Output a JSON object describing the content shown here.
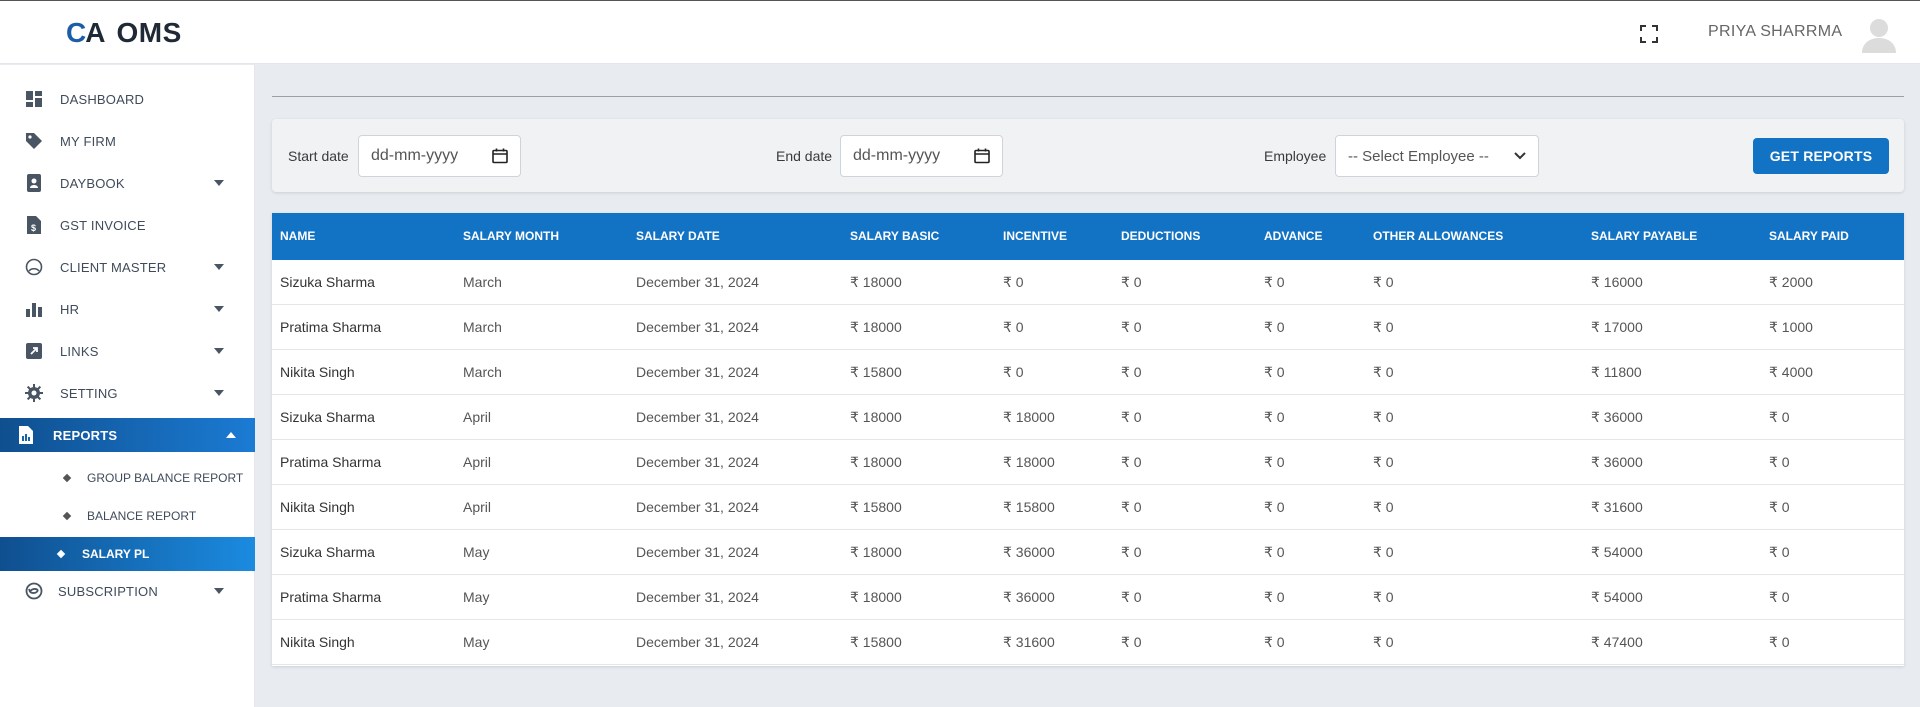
{
  "header": {
    "logo_mark_c": "C",
    "logo_mark_a": "A",
    "logo_text": "OMS",
    "username": "PRIYA SHARRMA"
  },
  "sidebar": {
    "items": [
      {
        "label": "DASHBOARD",
        "icon": "dashboard-icon"
      },
      {
        "label": "MY FIRM",
        "icon": "tag-icon"
      },
      {
        "label": "DAYBOOK",
        "icon": "book-icon"
      },
      {
        "label": "GST INVOICE",
        "icon": "invoice-icon"
      },
      {
        "label": "CLIENT MASTER",
        "icon": "client-icon"
      },
      {
        "label": "HR",
        "icon": "bar-chart-icon"
      },
      {
        "label": "LINKS",
        "icon": "link-icon"
      },
      {
        "label": "SETTING",
        "icon": "gear-icon"
      },
      {
        "label": "REPORTS",
        "icon": "report-icon"
      },
      {
        "label": "SUBSCRIPTION",
        "icon": "subscription-icon"
      }
    ],
    "reports_sub": [
      {
        "label": "GROUP BALANCE REPORT"
      },
      {
        "label": "BALANCE REPORT"
      },
      {
        "label": "SALARY PL"
      }
    ]
  },
  "filters": {
    "start_label": "Start date",
    "start_placeholder": "dd-mm-yyyy",
    "end_label": "End date",
    "end_placeholder": "dd-mm-yyyy",
    "employee_label": "Employee",
    "employee_selected": "-- Select Employee --",
    "button_label": "GET REPORTS"
  },
  "table": {
    "headers": [
      "NAME",
      "SALARY MONTH",
      "SALARY DATE",
      "SALARY BASIC",
      "INCENTIVE",
      "DEDUCTIONS",
      "ADVANCE",
      "OTHER ALLOWANCES",
      "SALARY PAYABLE",
      "SALARY PAID"
    ],
    "rows": [
      [
        "Sizuka Sharma",
        "March",
        "December 31, 2024",
        "₹ 18000",
        "₹ 0",
        "₹ 0",
        "₹ 0",
        "₹ 0",
        "₹ 16000",
        "₹ 2000"
      ],
      [
        "Pratima Sharma",
        "March",
        "December 31, 2024",
        "₹ 18000",
        "₹ 0",
        "₹ 0",
        "₹ 0",
        "₹ 0",
        "₹ 17000",
        "₹ 1000"
      ],
      [
        "Nikita Singh",
        "March",
        "December 31, 2024",
        "₹ 15800",
        "₹ 0",
        "₹ 0",
        "₹ 0",
        "₹ 0",
        "₹ 11800",
        "₹ 4000"
      ],
      [
        "Sizuka Sharma",
        "April",
        "December 31, 2024",
        "₹ 18000",
        "₹ 18000",
        "₹ 0",
        "₹ 0",
        "₹ 0",
        "₹ 36000",
        "₹ 0"
      ],
      [
        "Pratima Sharma",
        "April",
        "December 31, 2024",
        "₹ 18000",
        "₹ 18000",
        "₹ 0",
        "₹ 0",
        "₹ 0",
        "₹ 36000",
        "₹ 0"
      ],
      [
        "Nikita Singh",
        "April",
        "December 31, 2024",
        "₹ 15800",
        "₹ 15800",
        "₹ 0",
        "₹ 0",
        "₹ 0",
        "₹ 31600",
        "₹ 0"
      ],
      [
        "Sizuka Sharma",
        "May",
        "December 31, 2024",
        "₹ 18000",
        "₹ 36000",
        "₹ 0",
        "₹ 0",
        "₹ 0",
        "₹ 54000",
        "₹ 0"
      ],
      [
        "Pratima Sharma",
        "May",
        "December 31, 2024",
        "₹ 18000",
        "₹ 36000",
        "₹ 0",
        "₹ 0",
        "₹ 0",
        "₹ 54000",
        "₹ 0"
      ],
      [
        "Nikita Singh",
        "May",
        "December 31, 2024",
        "₹ 15800",
        "₹ 31600",
        "₹ 0",
        "₹ 0",
        "₹ 0",
        "₹ 47400",
        "₹ 0"
      ]
    ]
  },
  "colors": {
    "accent": "#1272c4",
    "brand_blue": "#1a5ea8"
  }
}
